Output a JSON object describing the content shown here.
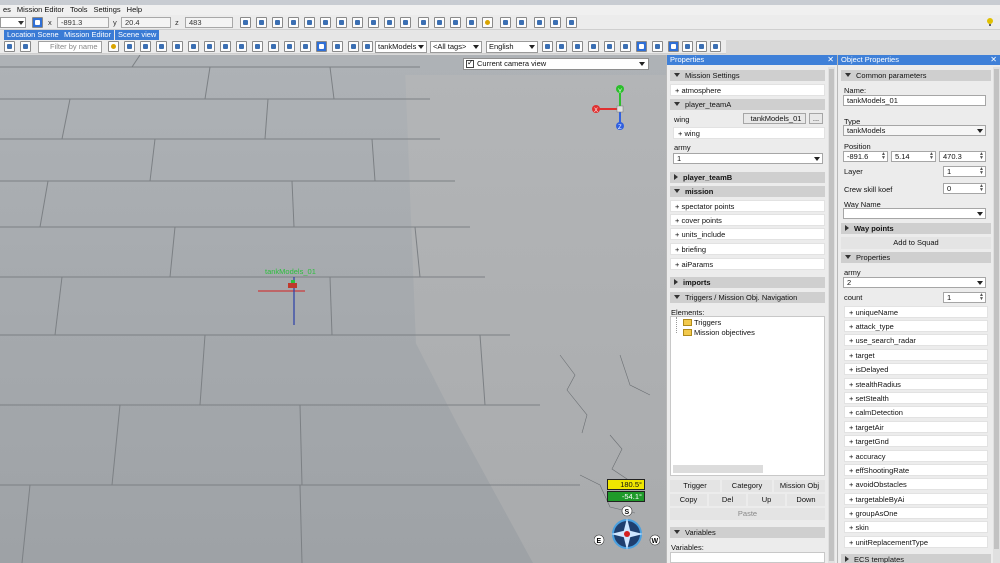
{
  "menu": [
    "es",
    "Mission Editor",
    "Tools",
    "Settings",
    "Help"
  ],
  "toolbar": {
    "x_label": "x",
    "x_value": "-891.3",
    "y_label": "y",
    "y_value": "20.4",
    "z_label": "z",
    "z_value": "483"
  },
  "tabs": [
    "Location Scene",
    "Mission Editor",
    "Scene view"
  ],
  "filter": {
    "placeholder": "Filter by name"
  },
  "selectors": {
    "model": "tankModels",
    "tags": "<All tags>",
    "language": "English"
  },
  "viewport": {
    "camera": "Current camera view",
    "unit_label": "tankModels_01",
    "heading": "180.5°",
    "pitch": "-54.1°",
    "gizmo_axes": [
      "Y",
      "X",
      "Z"
    ],
    "compass_letters": [
      "S",
      "E",
      "W"
    ]
  },
  "properties": {
    "title": "Properties",
    "mission_settings": "Mission Settings",
    "atmosphere": "+ atmosphere",
    "player_teamA": "player_teamA",
    "wing_label": "wing",
    "wing_value": "tankModels_01",
    "wing_more": "...",
    "wing_add": "+ wing",
    "army_label": "army",
    "army_value": "1",
    "player_teamB": "player_teamB",
    "mission": "mission",
    "mission_items": [
      "+ spectator points",
      "+ cover points",
      "+ units_include",
      "+ briefing",
      "+ aiParams"
    ],
    "imports": "imports",
    "triggers": "Triggers / Mission Obj. Navigation",
    "elements_label": "Elements:",
    "tree": [
      "Triggers",
      "Mission objectives"
    ],
    "buttons_row1": [
      "Trigger",
      "Category",
      "Mission Obj"
    ],
    "buttons_row2": [
      "Copy",
      "Del",
      "Up",
      "Down"
    ],
    "paste": "Paste",
    "variables": "Variables",
    "variables_label": "Variables:"
  },
  "object": {
    "title": "Object Properties",
    "common": "Common parameters",
    "name_label": "Name:",
    "name_value": "tankModels_01",
    "type_label": "Type",
    "type_value": "tankModels",
    "position_label": "Position",
    "pos_x": "-891.6",
    "pos_y": "5.14",
    "pos_z": "470.3",
    "layer_label": "Layer",
    "layer_value": "1",
    "crew_label": "Crew skill koef",
    "crew_value": "0",
    "way_label": "Way Name",
    "way_points": "Way points",
    "add_squad": "Add to Squad",
    "properties": "Properties",
    "army_label": "army",
    "army_value": "2",
    "count_label": "count",
    "count_value": "1",
    "items": [
      "+ uniqueName",
      "+ attack_type",
      "+ use_search_radar",
      "+ target",
      "+ isDelayed",
      "+ stealthRadius",
      "+ setStealth",
      "+ calmDetection",
      "+ targetAir",
      "+ targetGnd",
      "+ accuracy",
      "+ effShootingRate",
      "+ avoidObstacles",
      "+ targetableByAi",
      "+ groupAsOne",
      "+ skin",
      "+ unitReplacementType"
    ],
    "ecs": "ECS templates"
  },
  "colors": {
    "accent": "#3f80d8",
    "label_green": "#2cbf3c",
    "heading_yellow": "#f0e600",
    "pitch_green": "#1f9a2a"
  }
}
